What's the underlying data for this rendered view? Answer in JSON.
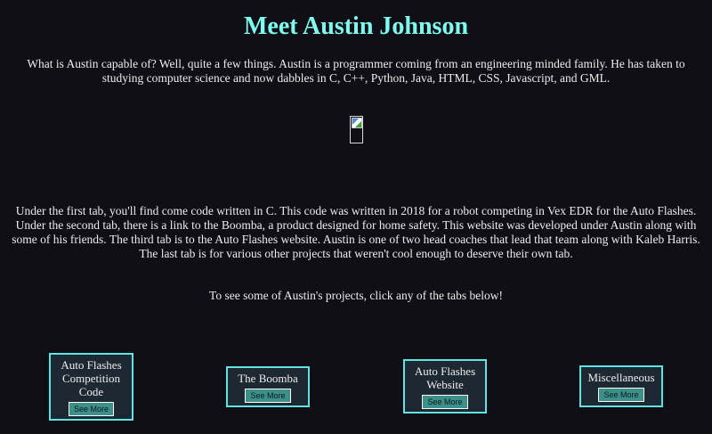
{
  "header": {
    "title": "Meet Austin Johnson"
  },
  "intro": {
    "text": "What is Austin capable of? Well, quite a few things. Austin is a programmer coming from an engineering minded family. He has taken to studying computer science and now dabbles in C, C++, Python, Java, HTML, CSS, Javascript, and GML."
  },
  "image": {
    "icon": "broken-image-icon"
  },
  "details": {
    "text": "Under the first tab, you'll find come code written in C. This code was written in 2018 for a robot competing in Vex EDR for the Auto Flashes. Under the second tab, there is a link to the Boomba, a product designed for home safety. This website was developed under Austin along with some of his friends. The third tab is to the Auto Flashes website. Austin is one of two head coaches that lead that team along with Kaleb Harris. The last tab is for various other projects that weren't cool enough to deserve their own tab."
  },
  "cta": {
    "text": "To see some of Austin's projects, click any of the tabs below!"
  },
  "tabs": [
    {
      "title": "Auto Flashes Competition Code",
      "button": "See More"
    },
    {
      "title": "The Boomba",
      "button": "See More"
    },
    {
      "title": "Auto Flashes Website",
      "button": "See More"
    },
    {
      "title": "Miscellaneous",
      "button": "See More"
    }
  ],
  "colors": {
    "background": "#0f0f15",
    "heading": "#7ffff0",
    "card_border": "#5fe3e3",
    "card_bg": "#1d2833",
    "button_bg": "#3c8f8a"
  }
}
